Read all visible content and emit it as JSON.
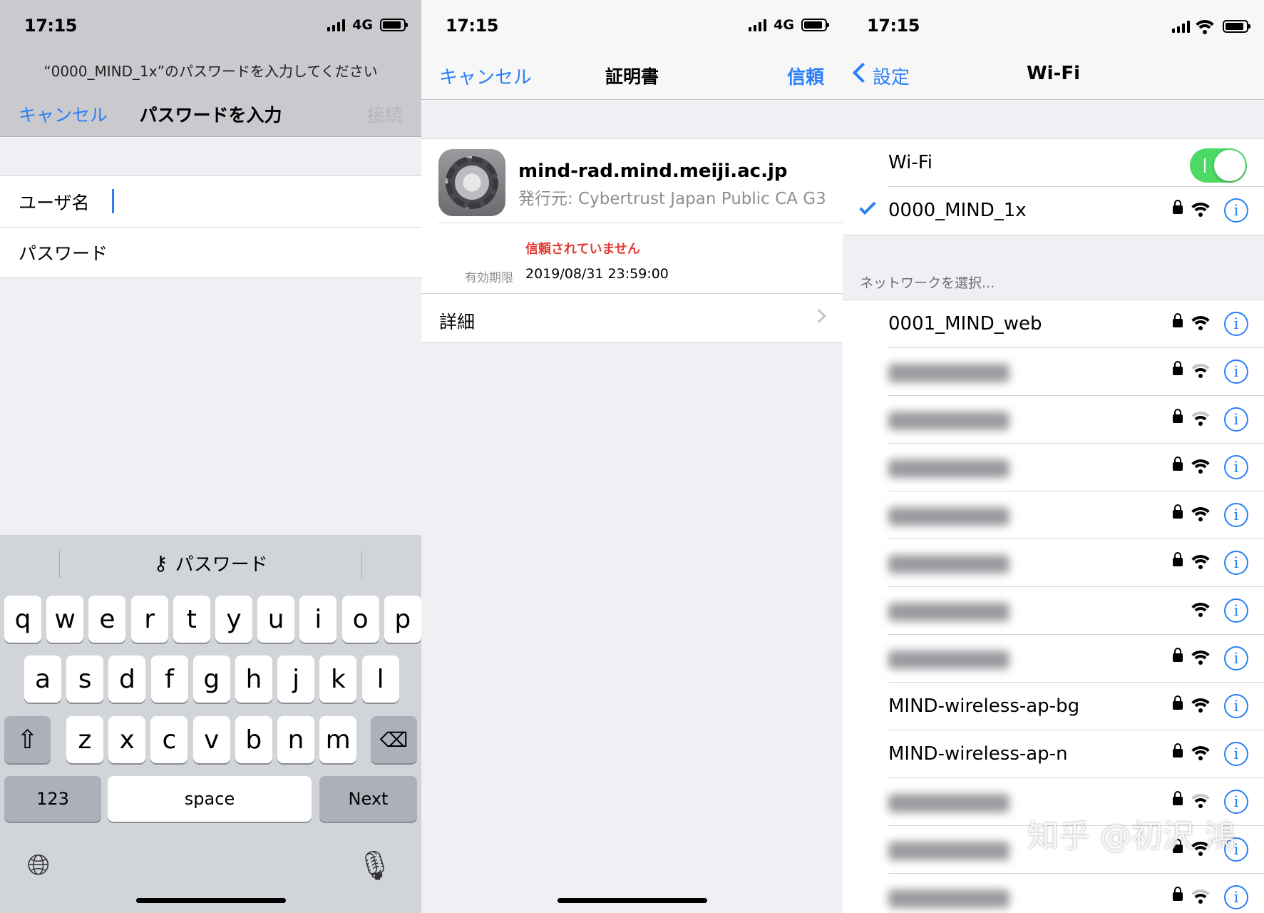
{
  "status": {
    "time": "17:15",
    "network": "4G"
  },
  "panel1": {
    "prompt": "“0000_MIND_1x”のパスワードを入力してください",
    "cancel": "キャンセル",
    "title": "パスワードを入力",
    "connect": "接続",
    "username_label": "ユーザ名",
    "password_label": "パスワード",
    "suggestion": "パスワード",
    "keys": {
      "row1": [
        "q",
        "w",
        "e",
        "r",
        "t",
        "y",
        "u",
        "i",
        "o",
        "p"
      ],
      "row2": [
        "a",
        "s",
        "d",
        "f",
        "g",
        "h",
        "j",
        "k",
        "l"
      ],
      "row3": [
        "z",
        "x",
        "c",
        "v",
        "b",
        "n",
        "m"
      ],
      "num": "123",
      "space": "space",
      "next": "Next"
    }
  },
  "panel2": {
    "cancel": "キャンセル",
    "title": "証明書",
    "trust": "信頼",
    "cert_name": "mind-rad.mind.meiji.ac.jp",
    "issuer": "発行元: Cybertrust Japan Public CA G3",
    "untrusted": "信頼されていません",
    "expires_label": "有効期限",
    "expires_value": "2019/08/31 23:59:00",
    "details": "詳細"
  },
  "panel3": {
    "back": "設定",
    "title": "Wi-Fi",
    "wifi_label": "Wi-Fi",
    "wifi_on": true,
    "connected": "0000_MIND_1x",
    "section_header": "ネットワークを選択...",
    "networks": [
      {
        "name": "0001_MIND_web",
        "locked": true,
        "blurred": false,
        "weak": false
      },
      {
        "name": "",
        "locked": true,
        "blurred": true,
        "weak": true
      },
      {
        "name": "",
        "locked": true,
        "blurred": true,
        "weak": true
      },
      {
        "name": "",
        "locked": true,
        "blurred": true,
        "weak": false
      },
      {
        "name": "",
        "locked": true,
        "blurred": true,
        "weak": false
      },
      {
        "name": "",
        "locked": true,
        "blurred": true,
        "weak": false
      },
      {
        "name": "",
        "locked": false,
        "blurred": true,
        "weak": false
      },
      {
        "name": "",
        "locked": true,
        "blurred": true,
        "weak": false
      },
      {
        "name": "MIND-wireless-ap-bg",
        "locked": true,
        "blurred": false,
        "weak": false
      },
      {
        "name": "MIND-wireless-ap-n",
        "locked": true,
        "blurred": false,
        "weak": false
      },
      {
        "name": "",
        "locked": true,
        "blurred": true,
        "weak": true
      },
      {
        "name": "",
        "locked": true,
        "blurred": true,
        "weak": false
      },
      {
        "name": "",
        "locked": true,
        "blurred": true,
        "weak": true
      }
    ],
    "watermark": "知乎 @初沢 鴻"
  },
  "colors": {
    "accent": "#2a7ff6",
    "toggle_on": "#4cd964",
    "warning": "#e23a30"
  }
}
